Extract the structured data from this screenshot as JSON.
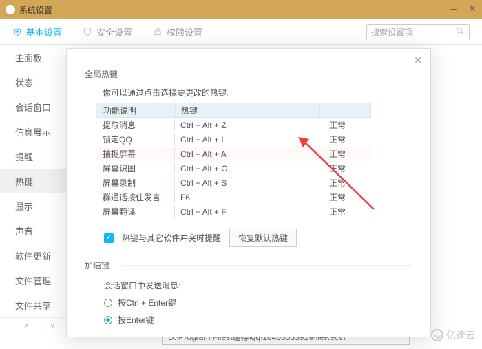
{
  "titlebar": {
    "title": "系统设置"
  },
  "topbar": {
    "tabs": [
      {
        "label": "基本设置"
      },
      {
        "label": "安全设置"
      },
      {
        "label": "权限设置"
      }
    ],
    "search_placeholder": "搜索设置项"
  },
  "sidebar": {
    "items": [
      "主面板",
      "状态",
      "会话窗口",
      "信息展示",
      "提醒",
      "热键",
      "显示",
      "声音",
      "软件更新",
      "文件管理",
      "文件共享"
    ],
    "selected_index": 5
  },
  "modal": {
    "global_hotkeys_title": "全局热键",
    "hint": "你可以通过点击选择要更改的热键。",
    "headers": {
      "func": "功能说明",
      "key": "热键",
      "status": ""
    },
    "rows": [
      {
        "func": "提取消息",
        "key": "Ctrl + Alt + Z",
        "status": "正常"
      },
      {
        "func": "锁定QQ",
        "key": "Ctrl + Alt + L",
        "status": "正常"
      },
      {
        "func": "捕捉屏幕",
        "key": "Ctrl + Alt + A",
        "status": "正常"
      },
      {
        "func": "屏幕识图",
        "key": "Ctrl + Alt + O",
        "status": "正常"
      },
      {
        "func": "屏幕录制",
        "key": "Ctrl + Alt + S",
        "status": "正常"
      },
      {
        "func": "群通话按住发言",
        "key": "F6",
        "status": "正常"
      },
      {
        "func": "屏幕翻译",
        "key": "Ctrl + Alt + F",
        "status": "正常"
      }
    ],
    "conflict_checkbox_label": "热键与其它软件冲突时提醒",
    "restore_button": "恢复默认热键",
    "accel_title": "加速键",
    "accel_hint": "会话窗口中发送消息:",
    "radios": [
      {
        "label": "按Ctrl + Enter键",
        "checked": false
      },
      {
        "label": "按Enter键",
        "checked": true
      }
    ]
  },
  "content": {
    "path": "D:\\Program Files\\缓存\\qq\\1848053391\\FileRecv\\"
  },
  "watermark": "亿速云",
  "colors": {
    "accent": "#12b7f5",
    "title_bg": "#d4a757",
    "arrow": "#f23b3b"
  }
}
